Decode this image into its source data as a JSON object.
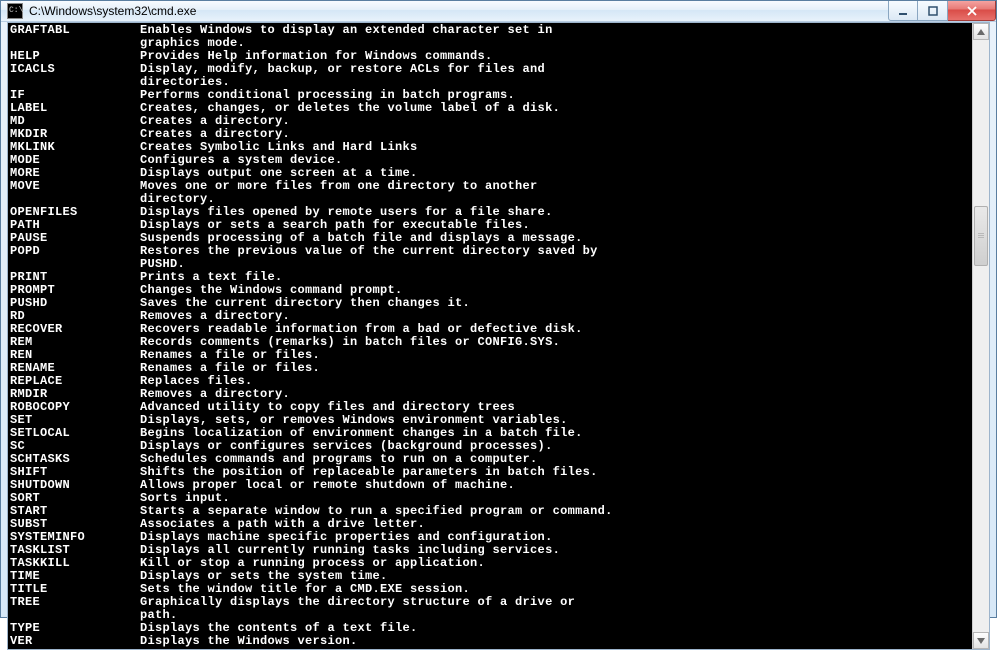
{
  "window": {
    "title": "C:\\Windows\\system32\\cmd.exe"
  },
  "commands": [
    {
      "name": "GRAFTABL",
      "desc": [
        "Enables Windows to display an extended character set in",
        "graphics mode."
      ]
    },
    {
      "name": "HELP",
      "desc": [
        "Provides Help information for Windows commands."
      ]
    },
    {
      "name": "ICACLS",
      "desc": [
        "Display, modify, backup, or restore ACLs for files and",
        "directories."
      ]
    },
    {
      "name": "IF",
      "desc": [
        "Performs conditional processing in batch programs."
      ]
    },
    {
      "name": "LABEL",
      "desc": [
        "Creates, changes, or deletes the volume label of a disk."
      ]
    },
    {
      "name": "MD",
      "desc": [
        "Creates a directory."
      ]
    },
    {
      "name": "MKDIR",
      "desc": [
        "Creates a directory."
      ]
    },
    {
      "name": "MKLINK",
      "desc": [
        "Creates Symbolic Links and Hard Links"
      ]
    },
    {
      "name": "MODE",
      "desc": [
        "Configures a system device."
      ]
    },
    {
      "name": "MORE",
      "desc": [
        "Displays output one screen at a time."
      ]
    },
    {
      "name": "MOVE",
      "desc": [
        "Moves one or more files from one directory to another",
        "directory."
      ]
    },
    {
      "name": "OPENFILES",
      "desc": [
        "Displays files opened by remote users for a file share."
      ]
    },
    {
      "name": "PATH",
      "desc": [
        "Displays or sets a search path for executable files."
      ]
    },
    {
      "name": "PAUSE",
      "desc": [
        "Suspends processing of a batch file and displays a message."
      ]
    },
    {
      "name": "POPD",
      "desc": [
        "Restores the previous value of the current directory saved by",
        "PUSHD."
      ]
    },
    {
      "name": "PRINT",
      "desc": [
        "Prints a text file."
      ]
    },
    {
      "name": "PROMPT",
      "desc": [
        "Changes the Windows command prompt."
      ]
    },
    {
      "name": "PUSHD",
      "desc": [
        "Saves the current directory then changes it."
      ]
    },
    {
      "name": "RD",
      "desc": [
        "Removes a directory."
      ]
    },
    {
      "name": "RECOVER",
      "desc": [
        "Recovers readable information from a bad or defective disk."
      ]
    },
    {
      "name": "REM",
      "desc": [
        "Records comments (remarks) in batch files or CONFIG.SYS."
      ]
    },
    {
      "name": "REN",
      "desc": [
        "Renames a file or files."
      ]
    },
    {
      "name": "RENAME",
      "desc": [
        "Renames a file or files."
      ]
    },
    {
      "name": "REPLACE",
      "desc": [
        "Replaces files."
      ]
    },
    {
      "name": "RMDIR",
      "desc": [
        "Removes a directory."
      ]
    },
    {
      "name": "ROBOCOPY",
      "desc": [
        "Advanced utility to copy files and directory trees"
      ]
    },
    {
      "name": "SET",
      "desc": [
        "Displays, sets, or removes Windows environment variables."
      ]
    },
    {
      "name": "SETLOCAL",
      "desc": [
        "Begins localization of environment changes in a batch file."
      ]
    },
    {
      "name": "SC",
      "desc": [
        "Displays or configures services (background processes)."
      ]
    },
    {
      "name": "SCHTASKS",
      "desc": [
        "Schedules commands and programs to run on a computer."
      ]
    },
    {
      "name": "SHIFT",
      "desc": [
        "Shifts the position of replaceable parameters in batch files."
      ]
    },
    {
      "name": "SHUTDOWN",
      "desc": [
        "Allows proper local or remote shutdown of machine."
      ]
    },
    {
      "name": "SORT",
      "desc": [
        "Sorts input."
      ]
    },
    {
      "name": "START",
      "desc": [
        "Starts a separate window to run a specified program or command."
      ]
    },
    {
      "name": "SUBST",
      "desc": [
        "Associates a path with a drive letter."
      ]
    },
    {
      "name": "SYSTEMINFO",
      "desc": [
        "Displays machine specific properties and configuration."
      ]
    },
    {
      "name": "TASKLIST",
      "desc": [
        "Displays all currently running tasks including services."
      ]
    },
    {
      "name": "TASKKILL",
      "desc": [
        "Kill or stop a running process or application."
      ]
    },
    {
      "name": "TIME",
      "desc": [
        "Displays or sets the system time."
      ]
    },
    {
      "name": "TITLE",
      "desc": [
        "Sets the window title for a CMD.EXE session."
      ]
    },
    {
      "name": "TREE",
      "desc": [
        "Graphically displays the directory structure of a drive or",
        "path."
      ]
    },
    {
      "name": "TYPE",
      "desc": [
        "Displays the contents of a text file."
      ]
    },
    {
      "name": "VER",
      "desc": [
        "Displays the Windows version."
      ]
    }
  ]
}
